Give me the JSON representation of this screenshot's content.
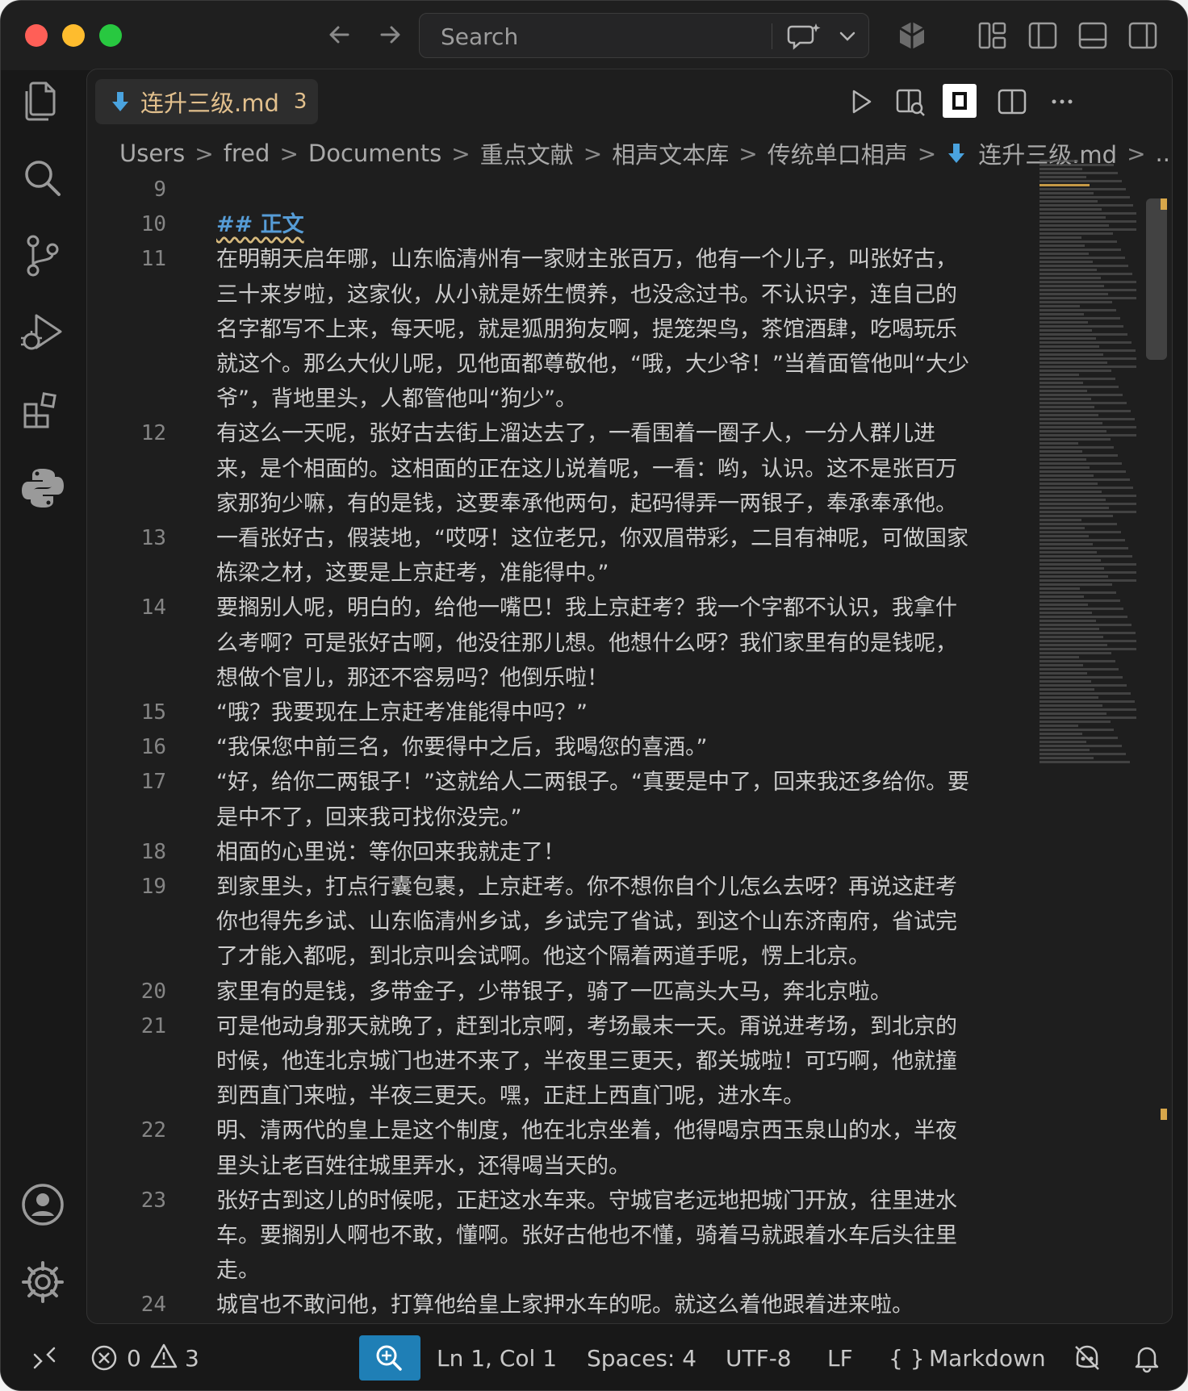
{
  "titlebar": {
    "search_placeholder": "Search"
  },
  "tab": {
    "label": "连升三级.md",
    "badge": "3"
  },
  "breadcrumb": [
    "Users",
    "fred",
    "Documents",
    "重点文献",
    "相声文本库",
    "传统单口相声",
    "连升三级.md",
    "..."
  ],
  "lines": [
    {
      "n": "9",
      "rows": [
        ""
      ]
    },
    {
      "n": "10",
      "rows": [
        "## 正文"
      ],
      "heading": true
    },
    {
      "n": "11",
      "rows": [
        "在明朝天启年哪，山东临清州有一家财主张百万，他有一个儿子，叫张好古，",
        "三十来岁啦，这家伙，从小就是娇生惯养，也没念过书。不认识字，连自己的",
        "名字都写不上来，每天呢，就是狐朋狗友啊，提笼架鸟，茶馆酒肆，吃喝玩乐",
        "就这个。那么大伙儿呢，见他面都尊敬他，“哦，大少爷！”当着面管他叫“大少",
        "爷”，背地里头，人都管他叫“狗少”。"
      ]
    },
    {
      "n": "12",
      "rows": [
        "有这么一天呢，张好古去街上溜达去了，一看围着一圈子人，一分人群儿进",
        "来，是个相面的。这相面的正在这儿说着呢，一看：哟，认识。这不是张百万",
        "家那狗少嘛，有的是钱，这要奉承他两句，起码得弄一两银子，奉承奉承他。"
      ]
    },
    {
      "n": "13",
      "rows": [
        "一看张好古，假装地，“哎呀！这位老兄，你双眉带彩，二目有神呢，可做国家",
        "栋梁之材，这要是上京赶考，准能得中。”"
      ]
    },
    {
      "n": "14",
      "rows": [
        "要搁别人呢，明白的，给他一嘴巴！我上京赶考？我一个字都不认识，我拿什",
        "么考啊？可是张好古啊，他没往那儿想。他想什么呀？我们家里有的是钱呢，",
        "想做个官儿，那还不容易吗？他倒乐啦！"
      ]
    },
    {
      "n": "15",
      "rows": [
        "“哦？我要现在上京赶考准能得中吗？”"
      ]
    },
    {
      "n": "16",
      "rows": [
        "“我保您中前三名，你要得中之后，我喝您的喜酒。”"
      ]
    },
    {
      "n": "17",
      "rows": [
        "“好，给你二两银子！”这就给人二两银子。“真要是中了，回来我还多给你。要",
        "是中不了，回来我可找你没完。”"
      ]
    },
    {
      "n": "18",
      "rows": [
        "相面的心里说：等你回来我就走了！"
      ]
    },
    {
      "n": "19",
      "rows": [
        "到家里头，打点行囊包裹，上京赶考。你不想你自个儿怎么去呀？再说这赶考",
        "你也得先乡试、山东临清州乡试，乡试完了省试，到这个山东济南府，省试完",
        "了才能入都呢，到北京叫会试啊。他这个隔着两道手呢，愣上北京。"
      ]
    },
    {
      "n": "20",
      "rows": [
        "家里有的是钱，多带金子，少带银子，骑了一匹高头大马，奔北京啦。"
      ]
    },
    {
      "n": "21",
      "rows": [
        "可是他动身那天就晚了，赶到北京啊，考场最末一天。甭说进考场，到北京的",
        "时候，他连北京城门也进不来了，半夜里三更天，都关城啦！可巧啊，他就撞",
        "到西直门来啦，半夜三更天。嘿，正赶上西直门呢，进水车。"
      ]
    },
    {
      "n": "22",
      "rows": [
        "明、清两代的皇上是这个制度，他在北京坐着，他得喝京西玉泉山的水，半夜",
        "里头让老百姓往城里弄水，还得喝当天的。"
      ]
    },
    {
      "n": "23",
      "rows": [
        "张好古到这儿的时候呢，正赶这水车来。守城官老远地把城门开放，往里进水",
        "车。要搁别人啊也不敢，懂啊。张好古他也不懂，骑着马就跟着水车后头往里",
        "走。"
      ]
    },
    {
      "n": "24",
      "rows": [
        "城官也不敢问他，打算他给皇上家押水车的呢。就这么着他跟着进来啦。"
      ]
    }
  ],
  "status": {
    "errors": "0",
    "warnings": "3",
    "position": "Ln 1, Col 1",
    "spaces": "Spaces: 4",
    "encoding": "UTF-8",
    "eol": "LF",
    "language": "Markdown"
  },
  "colors": {
    "accent": "#1f7fb6",
    "tab_text": "#e2c08d",
    "heading": "#569cd6"
  }
}
